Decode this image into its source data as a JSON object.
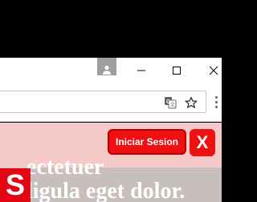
{
  "page": {
    "text_line1": "ectetuer",
    "text_line2": "ligula eget dolor."
  },
  "overlay": {
    "login_label": "Iniciar Sesion",
    "close_label": "X",
    "logo_letter": "S"
  },
  "colors": {
    "accent_red": "#ef1111",
    "content_bg": "#f6c9c9"
  }
}
